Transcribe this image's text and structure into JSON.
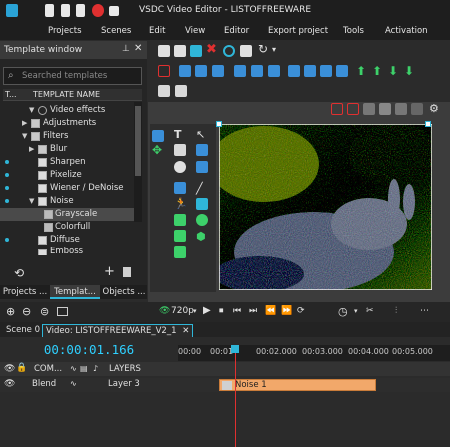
{
  "window": {
    "title": "VSDC Video Editor - LISTOFFREEWARE"
  },
  "menu": [
    "Projects",
    "Scenes",
    "Edit",
    "View",
    "Editor",
    "Export project",
    "Tools",
    "Activation"
  ],
  "template_window": {
    "title": "Template window",
    "search_placeholder": "Searched templates",
    "column_left": "T...",
    "column_name": "TEMPLATE NAME",
    "items": [
      {
        "label": "Video effects"
      },
      {
        "label": "Adjustments"
      },
      {
        "label": "Filters"
      },
      {
        "label": "Blur"
      },
      {
        "label": "Sharpen"
      },
      {
        "label": "Pixelize"
      },
      {
        "label": "Wiener / DeNoise"
      },
      {
        "label": "Noise"
      },
      {
        "label": "Grayscale"
      },
      {
        "label": "Colorfull"
      },
      {
        "label": "Diffuse"
      },
      {
        "label": "Emboss"
      }
    ],
    "tabs": [
      "Projects ...",
      "Templat...",
      "Objects ..."
    ]
  },
  "playback": {
    "quality": "720p"
  },
  "timeline": {
    "tabs": [
      "Scene 0",
      "Video: LISTOFFREEWARE_V2_1"
    ],
    "timecode": "00:00:01.166",
    "ruler": [
      "00:00",
      "00:01",
      "00:02.000",
      "00:03.000",
      "00:04.000",
      "00:05.000"
    ],
    "header": {
      "com": "COM...",
      "layers": "LAYERS"
    },
    "track": {
      "blend": "Blend",
      "layer": "Layer 3",
      "clip": "Noise 1"
    }
  },
  "colors": {
    "accent": "#2fb6d8",
    "clip": "#f2a86a",
    "playhead": "#e03030",
    "timecode": "#2fd0ff"
  }
}
